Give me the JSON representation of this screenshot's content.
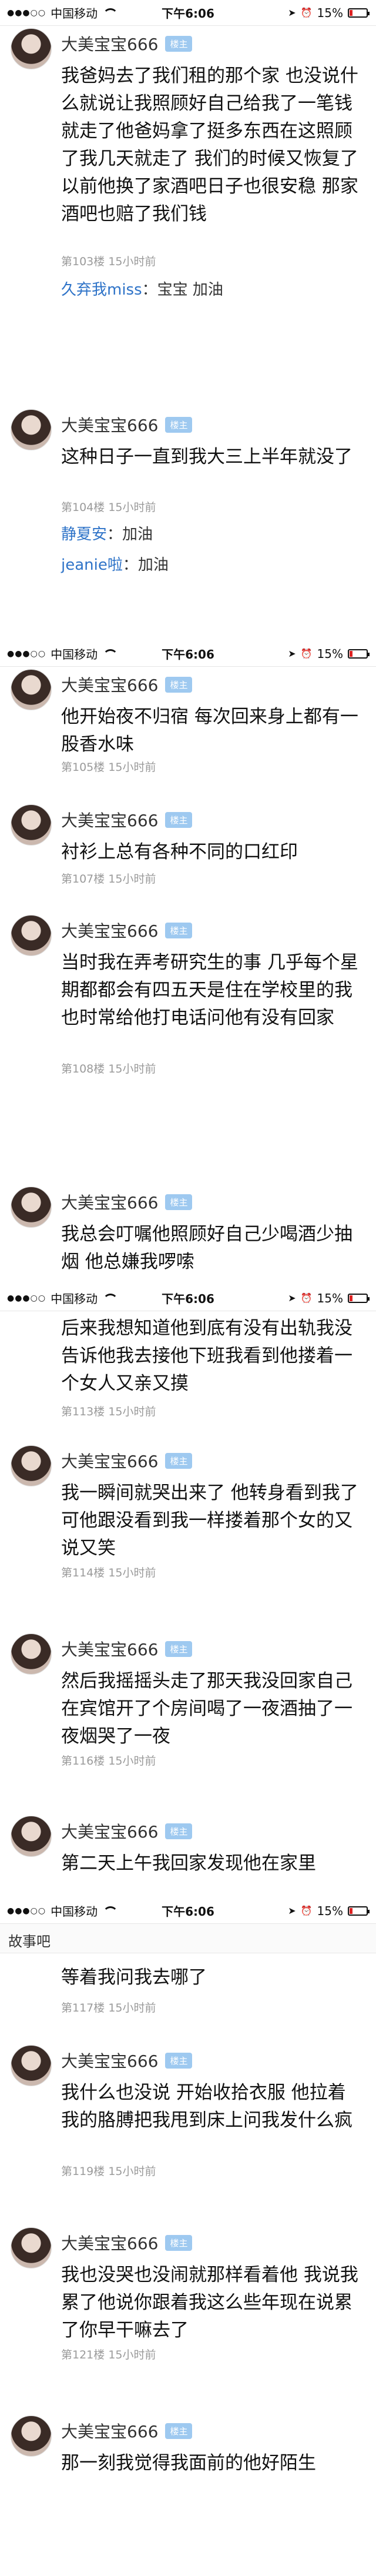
{
  "status_bar": {
    "carrier": "中国移动",
    "time": "下午6:06",
    "battery": "15%"
  },
  "user": {
    "name": "大美宝宝666",
    "badge": "楼主"
  },
  "section_head": "故事吧",
  "comments": [
    {
      "text": "我爸妈去了我们租的那个家 也没说什么就说让我照顾好自己给我了一笔钱就走了他爸妈拿了挺多东西在这照顾了我几天就走了 我们的时候又恢复了以前他换了家酒吧日子也很安稳 那家酒吧也赔了我们钱",
      "floor": "第103楼",
      "time": "15小时前",
      "replies": [
        {
          "name": "久弃我miss",
          "text": "宝宝 加油"
        }
      ]
    },
    {
      "text": "这种日子一直到我大三上半年就没了",
      "floor": "第104楼",
      "time": "15小时前",
      "replies": [
        {
          "name": "静夏安",
          "text": "加油"
        },
        {
          "name": "jeanie啦",
          "text": "加油"
        }
      ]
    },
    {
      "text": "他开始夜不归宿 每次回来身上都有一股香水味",
      "floor": "第105楼",
      "time": "15小时前",
      "replies": []
    },
    {
      "text": "衬衫上总有各种不同的口红印",
      "floor": "第107楼",
      "time": "15小时前",
      "replies": []
    },
    {
      "text": "当时我在弄考研究生的事 几乎每个星期都都会有四五天是住在学校里的我也时常给他打电话问他有没有回家",
      "floor": "第108楼",
      "time": "15小时前",
      "replies": []
    },
    {
      "text": "我总会叮嘱他照顾好自己少喝酒少抽烟 他总嫌我啰嗦",
      "floor": "",
      "time": "",
      "replies": []
    },
    {
      "text": "后来我想知道他到底有没有出轨我没告诉他我去接他下班我看到他搂着一个女人又亲又摸",
      "floor": "第113楼",
      "time": "15小时前",
      "replies": []
    },
    {
      "text": "我一瞬间就哭出来了 他转身看到我了可他跟没看到我一样搂着那个女的又说又笑",
      "floor": "第114楼",
      "time": "15小时前",
      "replies": []
    },
    {
      "text": "然后我摇摇头走了那天我没回家自己在宾馆开了个房间喝了一夜酒抽了一夜烟哭了一夜",
      "floor": "第116楼",
      "time": "15小时前",
      "replies": []
    },
    {
      "text": "第二天上午我回家发现他在家里",
      "floor": "",
      "time": "",
      "replies": []
    },
    {
      "text": "等着我问我去哪了",
      "floor": "第117楼",
      "time": "15小时前",
      "replies": []
    },
    {
      "text": "我什么也没说 开始收拾衣服 他拉着我的胳膊把我甩到床上问我发什么疯",
      "floor": "第119楼",
      "time": "15小时前",
      "replies": []
    },
    {
      "text": "我也没哭也没闹就那样看着他 我说我累了他说你跟着我这么些年现在说累了你早干嘛去了",
      "floor": "第121楼",
      "time": "15小时前",
      "replies": []
    },
    {
      "text": "那一刻我觉得我面前的他好陌生",
      "floor": "",
      "time": "",
      "replies": []
    }
  ]
}
